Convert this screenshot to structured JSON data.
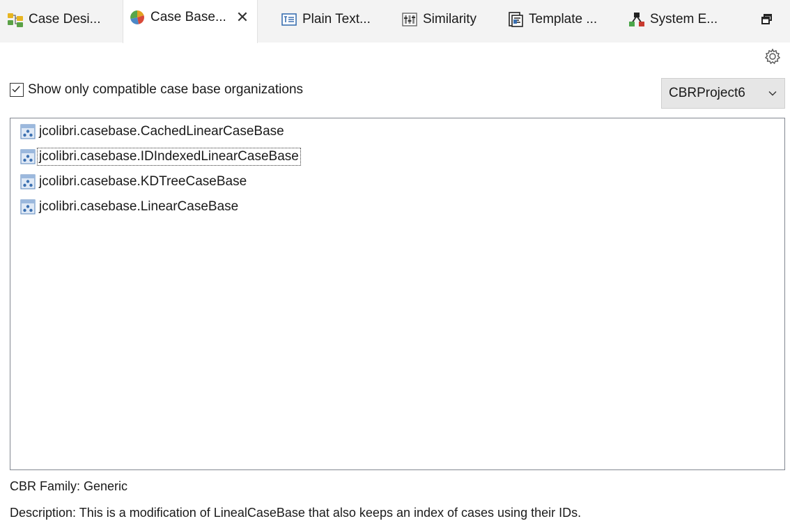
{
  "tabs": [
    {
      "label": "Case Desi...",
      "icon": "case-design-icon",
      "active": false
    },
    {
      "label": "Case Base...",
      "icon": "case-base-icon",
      "active": true
    },
    {
      "label": "Plain Text...",
      "icon": "plain-text-icon",
      "active": false
    },
    {
      "label": "Similarity",
      "icon": "similarity-icon",
      "active": false
    },
    {
      "label": "Template ...",
      "icon": "template-icon",
      "active": false
    },
    {
      "label": "System E...",
      "icon": "system-evaluation-icon",
      "active": false
    }
  ],
  "close_glyph": "✕",
  "filter": {
    "label": "Show only compatible case base organizations",
    "checked": true
  },
  "project": {
    "selected": "CBRProject6"
  },
  "case_bases": [
    {
      "label": "jcolibri.casebase.CachedLinearCaseBase",
      "selected": false
    },
    {
      "label": "jcolibri.casebase.IDIndexedLinearCaseBase",
      "selected": true
    },
    {
      "label": "jcolibri.casebase.KDTreeCaseBase",
      "selected": false
    },
    {
      "label": "jcolibri.casebase.LinearCaseBase",
      "selected": false
    }
  ],
  "details": {
    "family": "CBR Family: Generic",
    "description": "Description: This is a modification of LinealCaseBase that also keeps an index of cases using their IDs."
  },
  "colors": {
    "accent_blue": "#3a6fb0",
    "selected_outline": "#333333",
    "select_bg": "#e6e6e6"
  }
}
